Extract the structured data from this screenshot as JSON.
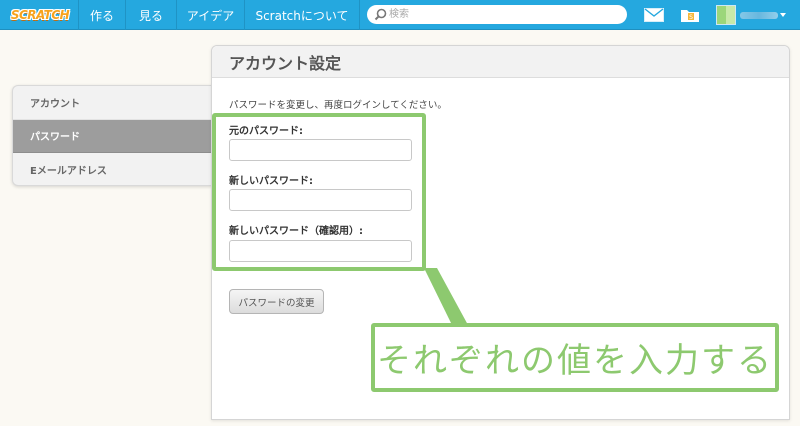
{
  "nav": {
    "logo": "SCRATCH",
    "items": [
      "作る",
      "見る",
      "アイデア",
      "Scratchについて"
    ],
    "search_placeholder": "検索"
  },
  "sidebar": {
    "items": [
      {
        "label": "アカウント"
      },
      {
        "label": "パスワード"
      },
      {
        "label": "Eメールアドレス"
      }
    ]
  },
  "panel": {
    "title": "アカウント設定",
    "instruction": "パスワードを変更し、再度ログインしてください。",
    "fields": [
      {
        "label": "元のパスワード:",
        "value": ""
      },
      {
        "label": "新しいパスワード:",
        "value": ""
      },
      {
        "label": "新しいパスワード（確認用）:",
        "value": ""
      }
    ],
    "submit_label": "パスワードの変更"
  },
  "annotation": {
    "text": "それぞれの値を入力する",
    "color": "#8dc96f"
  },
  "colors": {
    "nav_bg": "#25a8df",
    "active_sidebar": "#9d9d9d"
  }
}
